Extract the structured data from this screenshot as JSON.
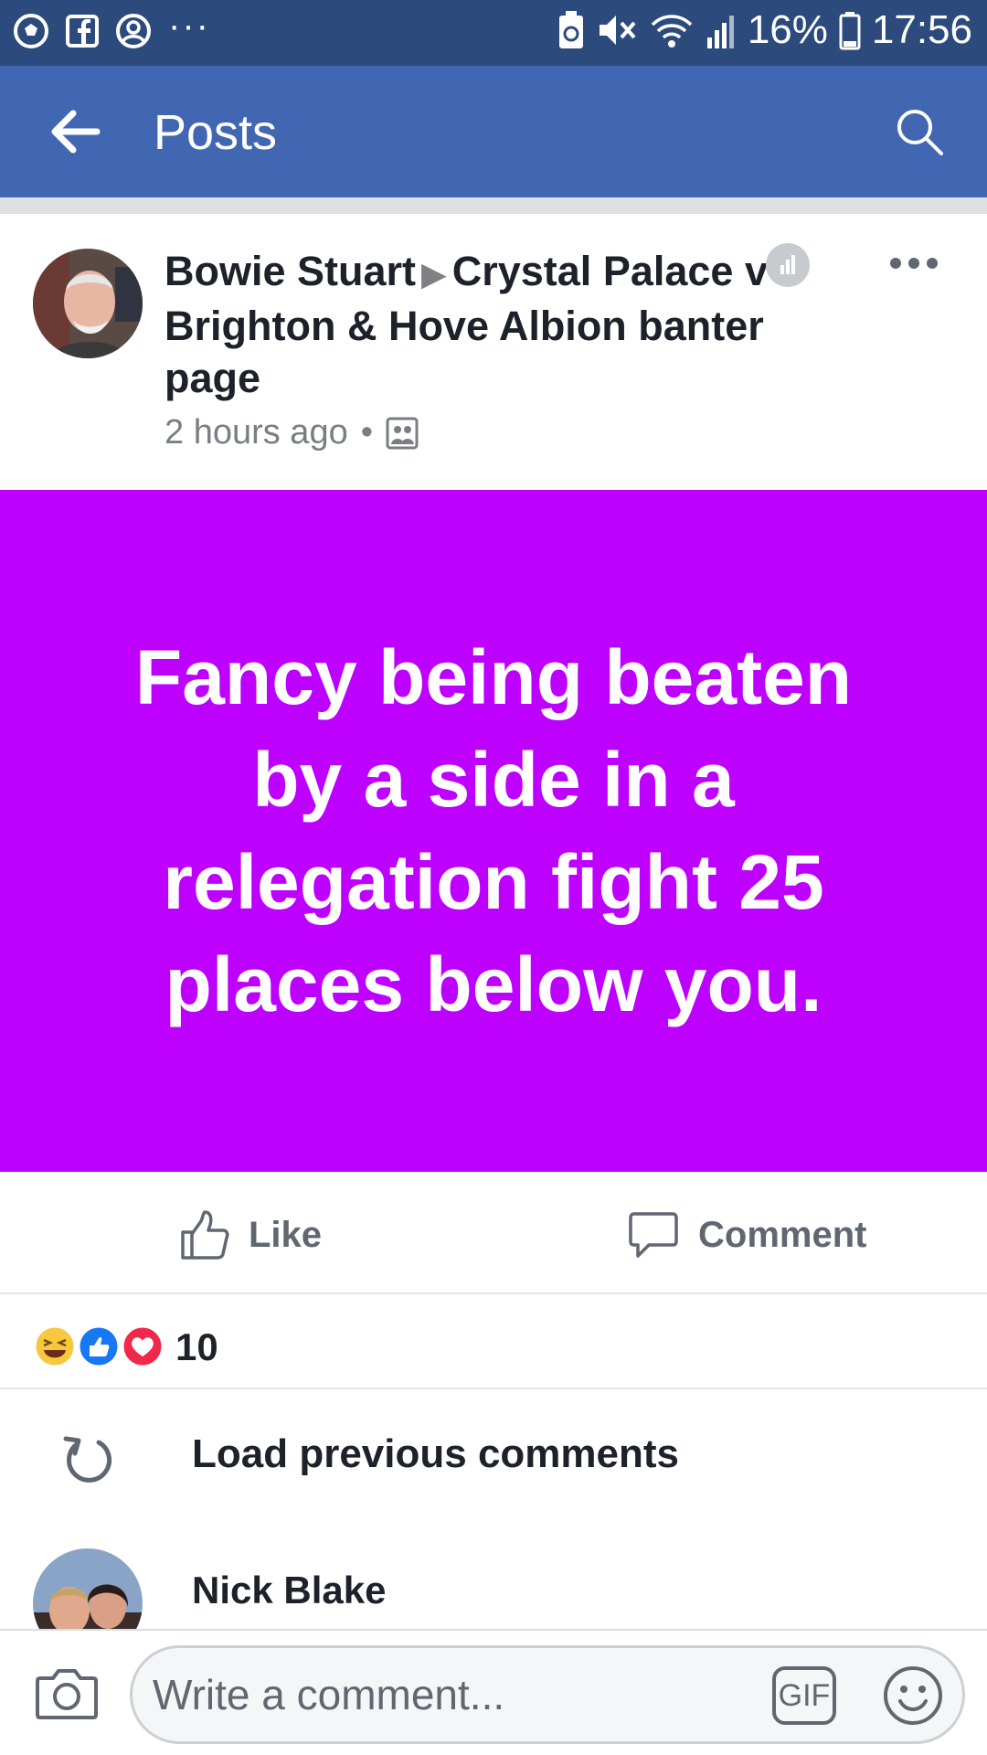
{
  "status_bar": {
    "battery": "16%",
    "time": "17:56",
    "more": "···"
  },
  "header": {
    "title": "Posts"
  },
  "post": {
    "author": "Bowie Stuart",
    "target": "Crystal Palace v Brighton & Hove Albion banter page",
    "time": "2 hours ago",
    "separator": "•",
    "text": "Fancy being beaten by a side in a relegation fight 25 places below you.",
    "background_color": "#bd00ff"
  },
  "actions": {
    "like": "Like",
    "comment": "Comment"
  },
  "reactions": {
    "count": "10"
  },
  "comments": {
    "load_previous": "Load previous comments",
    "items": [
      {
        "name": "Nick Blake"
      }
    ]
  },
  "composer": {
    "placeholder": "Write a comment...",
    "gif_label": "GIF"
  }
}
